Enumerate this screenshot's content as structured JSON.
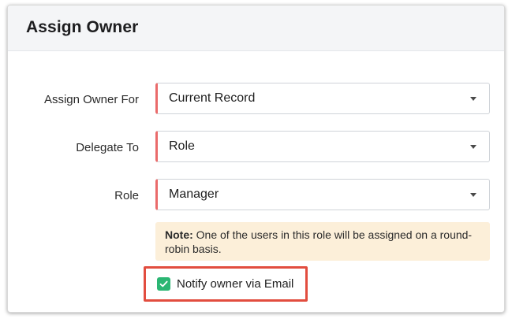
{
  "dialog": {
    "title": "Assign Owner"
  },
  "fields": [
    {
      "label": "Assign Owner For",
      "value": "Current Record"
    },
    {
      "label": "Delegate To",
      "value": "Role"
    },
    {
      "label": "Role",
      "value": "Manager"
    }
  ],
  "note": {
    "prefix": "Note:",
    "text": "One of the users in this role will be assigned on a round-robin basis."
  },
  "notify": {
    "label": "Notify owner via Email",
    "checked": true
  },
  "colors": {
    "required_marker": "#ea6b6b",
    "checkbox": "#2bb673",
    "highlight_box": "#e24d3f",
    "note_background": "#fcefd9"
  },
  "icons": {
    "dropdown": "chevron-down-icon",
    "checkbox": "checkmark-icon"
  }
}
